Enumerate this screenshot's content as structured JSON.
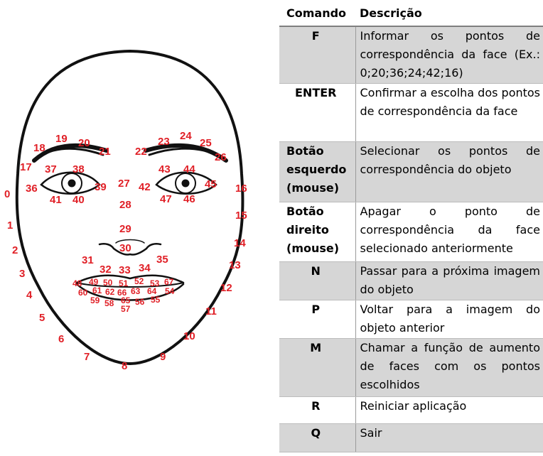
{
  "table": {
    "headers": [
      "Comando",
      "Descrição"
    ],
    "rows": [
      {
        "cmd": "F",
        "desc": "Informar os pontos de correspondência da face (Ex.: 0;20;36;24;42;16)"
      },
      {
        "cmd": "ENTER",
        "desc": "Confirmar a escolha dos pontos de correspondência da face"
      },
      {
        "cmd": "Botão esquerdo (mouse)",
        "desc": "Selecionar os pontos de correspondência do objeto"
      },
      {
        "cmd": "Botão direito (mouse)",
        "desc": "Apagar o ponto de correspondência da face selecionado anteriormente"
      },
      {
        "cmd": "N",
        "desc": "Passar para a próxima imagem do objeto"
      },
      {
        "cmd": "P",
        "desc": "Voltar para a imagem do objeto anterior"
      },
      {
        "cmd": "M",
        "desc": "Chamar a função de aumento de faces com os pontos escolhidos"
      },
      {
        "cmd": "R",
        "desc": "Reiniciar aplicação"
      },
      {
        "cmd": "Q",
        "desc": "Sair"
      }
    ]
  },
  "landmarks": [
    "0",
    "1",
    "2",
    "3",
    "4",
    "5",
    "6",
    "7",
    "8",
    "9",
    "10",
    "11",
    "12",
    "13",
    "14",
    "15",
    "16",
    "17",
    "18",
    "19",
    "20",
    "21",
    "22",
    "23",
    "24",
    "25",
    "26",
    "27",
    "28",
    "29",
    "30",
    "31",
    "32",
    "33",
    "34",
    "35",
    "36",
    "37",
    "38",
    "39",
    "40",
    "41",
    "42",
    "43",
    "44",
    "45",
    "46",
    "47",
    "48",
    "49",
    "50",
    "51",
    "52",
    "53",
    "54",
    "55",
    "56",
    "57",
    "58",
    "59",
    "60",
    "61",
    "62",
    "63",
    "64",
    "65",
    "66",
    "67"
  ],
  "colors": {
    "landmark": "#e01f26",
    "row_shade": "#d6d6d6",
    "face_line": "#111111"
  }
}
